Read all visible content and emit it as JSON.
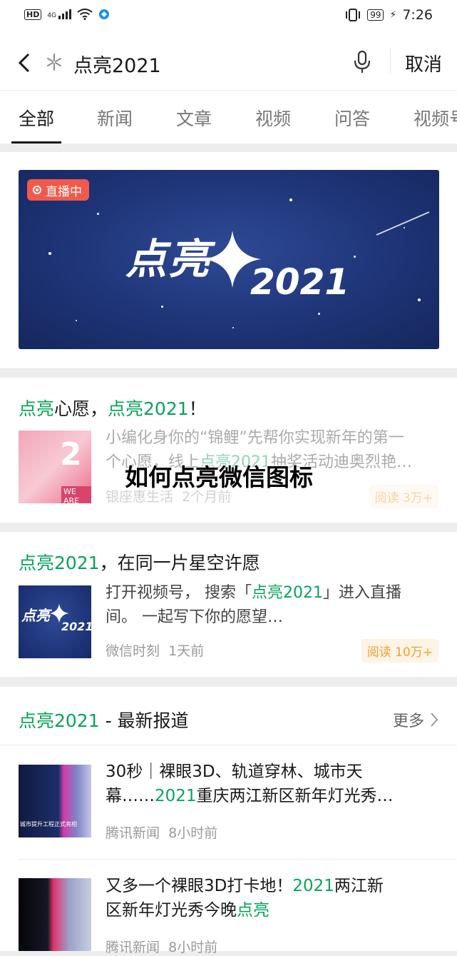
{
  "status_bar": {
    "network": "HD",
    "signal": "4G",
    "battery": "99",
    "time": "7:26"
  },
  "search": {
    "query": "点亮2021",
    "cancel_label": "取消"
  },
  "tabs": [
    {
      "label": "全部"
    },
    {
      "label": "新闻"
    },
    {
      "label": "文章"
    },
    {
      "label": "视频"
    },
    {
      "label": "问答"
    },
    {
      "label": "视频号"
    }
  ],
  "banner": {
    "live_label": "直播中",
    "word": "点亮",
    "year": "2021"
  },
  "result1": {
    "title_hl1": "点亮",
    "title_mid": "心愿，",
    "title_hl2": "点亮2021",
    "title_end": "！",
    "desc_a": "小编化身你的“锦鲤”先帮你实现新年的第一",
    "desc_b": "个心愿，线上",
    "desc_hl": "点亮2021",
    "desc_c": "抽奖活动迪奥烈艳…",
    "source": "银座惠生活",
    "time": "2个月前",
    "reads": "阅读 3万+",
    "thumb_text": "WE ARE"
  },
  "overlay_title": "如何点亮微信图标",
  "result2": {
    "title_hl": "点亮2021",
    "title_rest": "，在同一片星空许愿",
    "desc_a": "打开视频号， 搜索「",
    "desc_hl": "点亮2021",
    "desc_b": "」进入直播",
    "desc_c": "间。 一起写下你的愿望…",
    "source": "微信时刻",
    "time": "1天前",
    "reads": "阅读 10万+",
    "thumb_word": "点亮",
    "thumb_year": "2021"
  },
  "news_section": {
    "title_hl": "点亮2021",
    "title_rest": " - 最新报道",
    "more_label": "更多",
    "items": [
      {
        "line1": "30秒｜裸眼3D、轨道穿林、城市天",
        "line2_a": "幕……",
        "line2_hl": "2021",
        "line2_b": "重庆两江新区新年灯光秀…",
        "source": "腾讯新闻",
        "time": "8小时前",
        "thumb_text": "城市提升工程正式亮相"
      },
      {
        "line1_a": "又多一个裸眼3D打卡地！",
        "line1_hl": "2021",
        "line1_b": "两江新",
        "line2_a": "区新年灯光秀今晚",
        "line2_hl": "点亮",
        "source": "腾讯新闻",
        "time": "8小时前"
      }
    ]
  },
  "colors": {
    "accent": "#07a459",
    "live": "#f15a4a",
    "banner_bg": "#1e3477",
    "badge": "#f0a030"
  }
}
